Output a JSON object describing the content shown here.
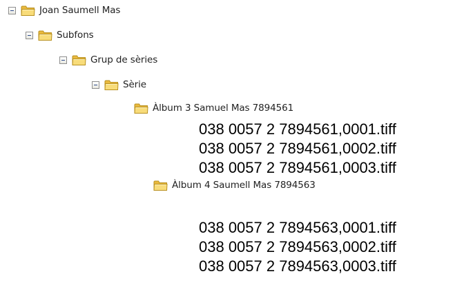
{
  "tree": {
    "root": {
      "label": "Joan Saumell Mas",
      "icon": "folder-icon",
      "expanded": true
    },
    "subfons": {
      "label": "Subfons",
      "icon": "folder-icon",
      "expanded": true
    },
    "grup": {
      "label": "Grup de sèries",
      "icon": "folder-icon",
      "expanded": true
    },
    "serie": {
      "label": "Sèrie",
      "icon": "folder-icon",
      "expanded": true
    },
    "album3": {
      "label": "Àlbum 3 Samuel Mas 7894561",
      "icon": "folder-icon",
      "files": [
        "038 0057 2 7894561,0001.tiff",
        "038 0057 2 7894561,0002.tiff",
        "038 0057 2 7894561,0003.tiff"
      ]
    },
    "album4": {
      "label": "Àlbum 4 Saumell Mas 7894563",
      "icon": "folder-icon",
      "files": [
        "038 0057 2 7894563,0001.tiff",
        "038 0057 2 7894563,0002.tiff",
        "038 0057 2 7894563,0003.tiff"
      ]
    }
  },
  "colors": {
    "folder_fill": "#f6d56a",
    "folder_edge": "#b8901f",
    "toggle_border": "#8d8d8d",
    "text": "#222222"
  }
}
